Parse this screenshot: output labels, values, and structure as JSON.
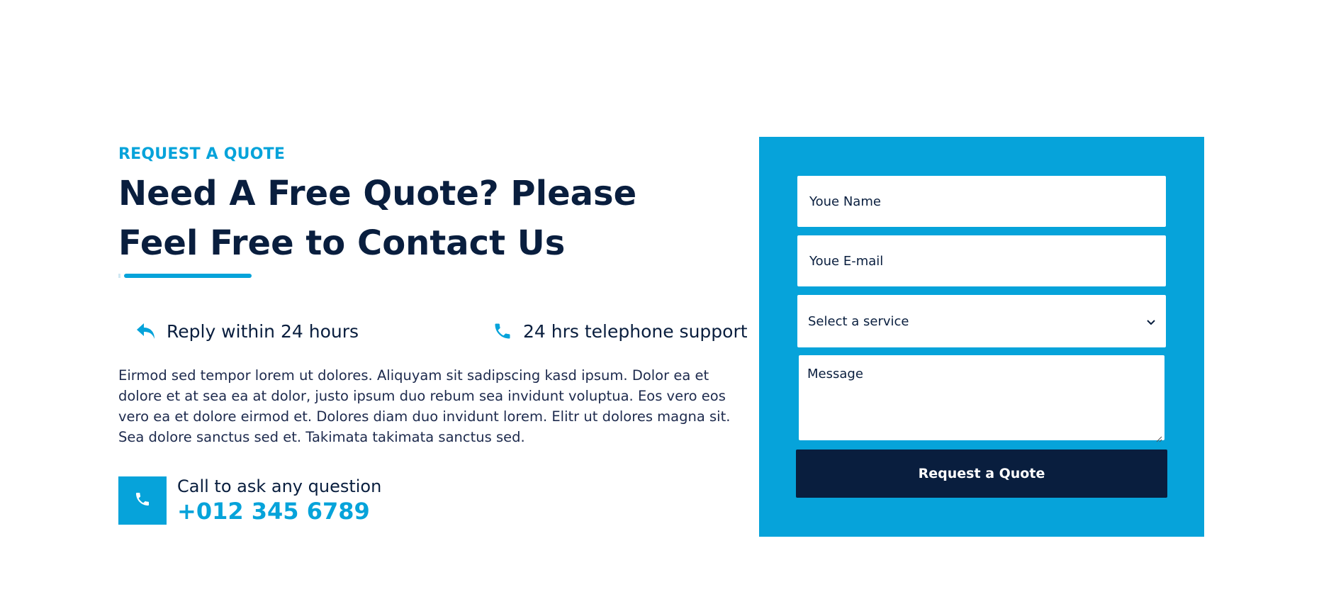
{
  "section": {
    "eyebrow": "REQUEST A QUOTE",
    "headline": "Need A Free Quote? Please Feel Free to Contact Us",
    "features": [
      {
        "icon": "reply-icon",
        "label": "Reply within 24 hours"
      },
      {
        "icon": "phone-icon",
        "label": "24 hrs telephone support"
      }
    ],
    "paragraph": "Eirmod sed tempor lorem ut dolores. Aliquyam sit sadipscing kasd ipsum. Dolor ea et dolore et at sea ea at dolor, justo ipsum duo rebum sea invidunt voluptua. Eos vero eos vero ea et dolore eirmod et. Dolores diam duo invidunt lorem. Elitr ut dolores magna sit. Sea dolore sanctus sed et. Takimata takimata sanctus sed.",
    "call": {
      "icon": "phone-icon",
      "label": "Call to ask any question",
      "number": "+012 345 6789"
    }
  },
  "form": {
    "name_placeholder": "Youe Name",
    "email_placeholder": "Youe E-mail",
    "service_selected": "Select a service",
    "message_placeholder": "Message",
    "submit_label": "Request a Quote"
  },
  "colors": {
    "primary": "#06a3da",
    "dark": "#091e3e",
    "background": "#ffffff"
  }
}
